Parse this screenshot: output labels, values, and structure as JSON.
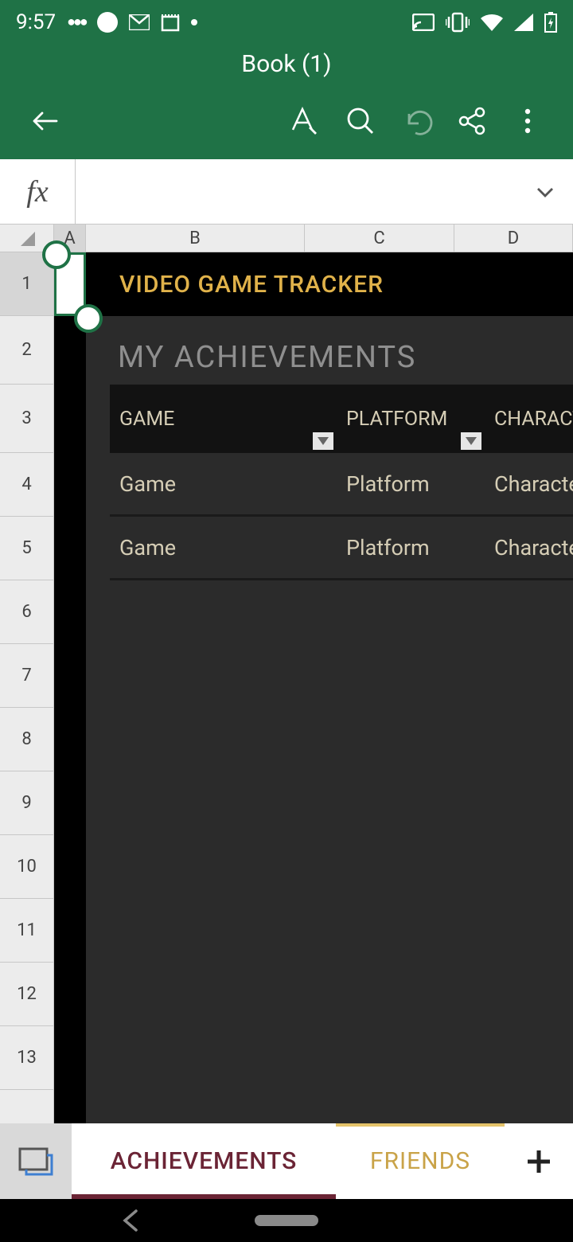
{
  "status": {
    "time": "9:57"
  },
  "app": {
    "title": "Book (1)"
  },
  "fx": {
    "symbol": "fx",
    "value": ""
  },
  "columns": {
    "a": "A",
    "b": "B",
    "c": "C",
    "d": "D"
  },
  "rows": [
    "1",
    "2",
    "3",
    "4",
    "5",
    "6",
    "7",
    "8",
    "9",
    "10",
    "11",
    "12",
    "13"
  ],
  "sheet": {
    "title": "VIDEO GAME TRACKER",
    "subtitle": "MY ACHIEVEMENTS",
    "headers": {
      "game": "GAME",
      "platform": "PLATFORM",
      "character": "CHARACTER PL"
    },
    "data_rows": [
      {
        "game": "Game",
        "platform": "Platform",
        "character": "Character"
      },
      {
        "game": "Game",
        "platform": "Platform",
        "character": "Character"
      }
    ]
  },
  "tabs": {
    "achievements": "ACHIEVEMENTS",
    "friends": "FRIENDS"
  }
}
